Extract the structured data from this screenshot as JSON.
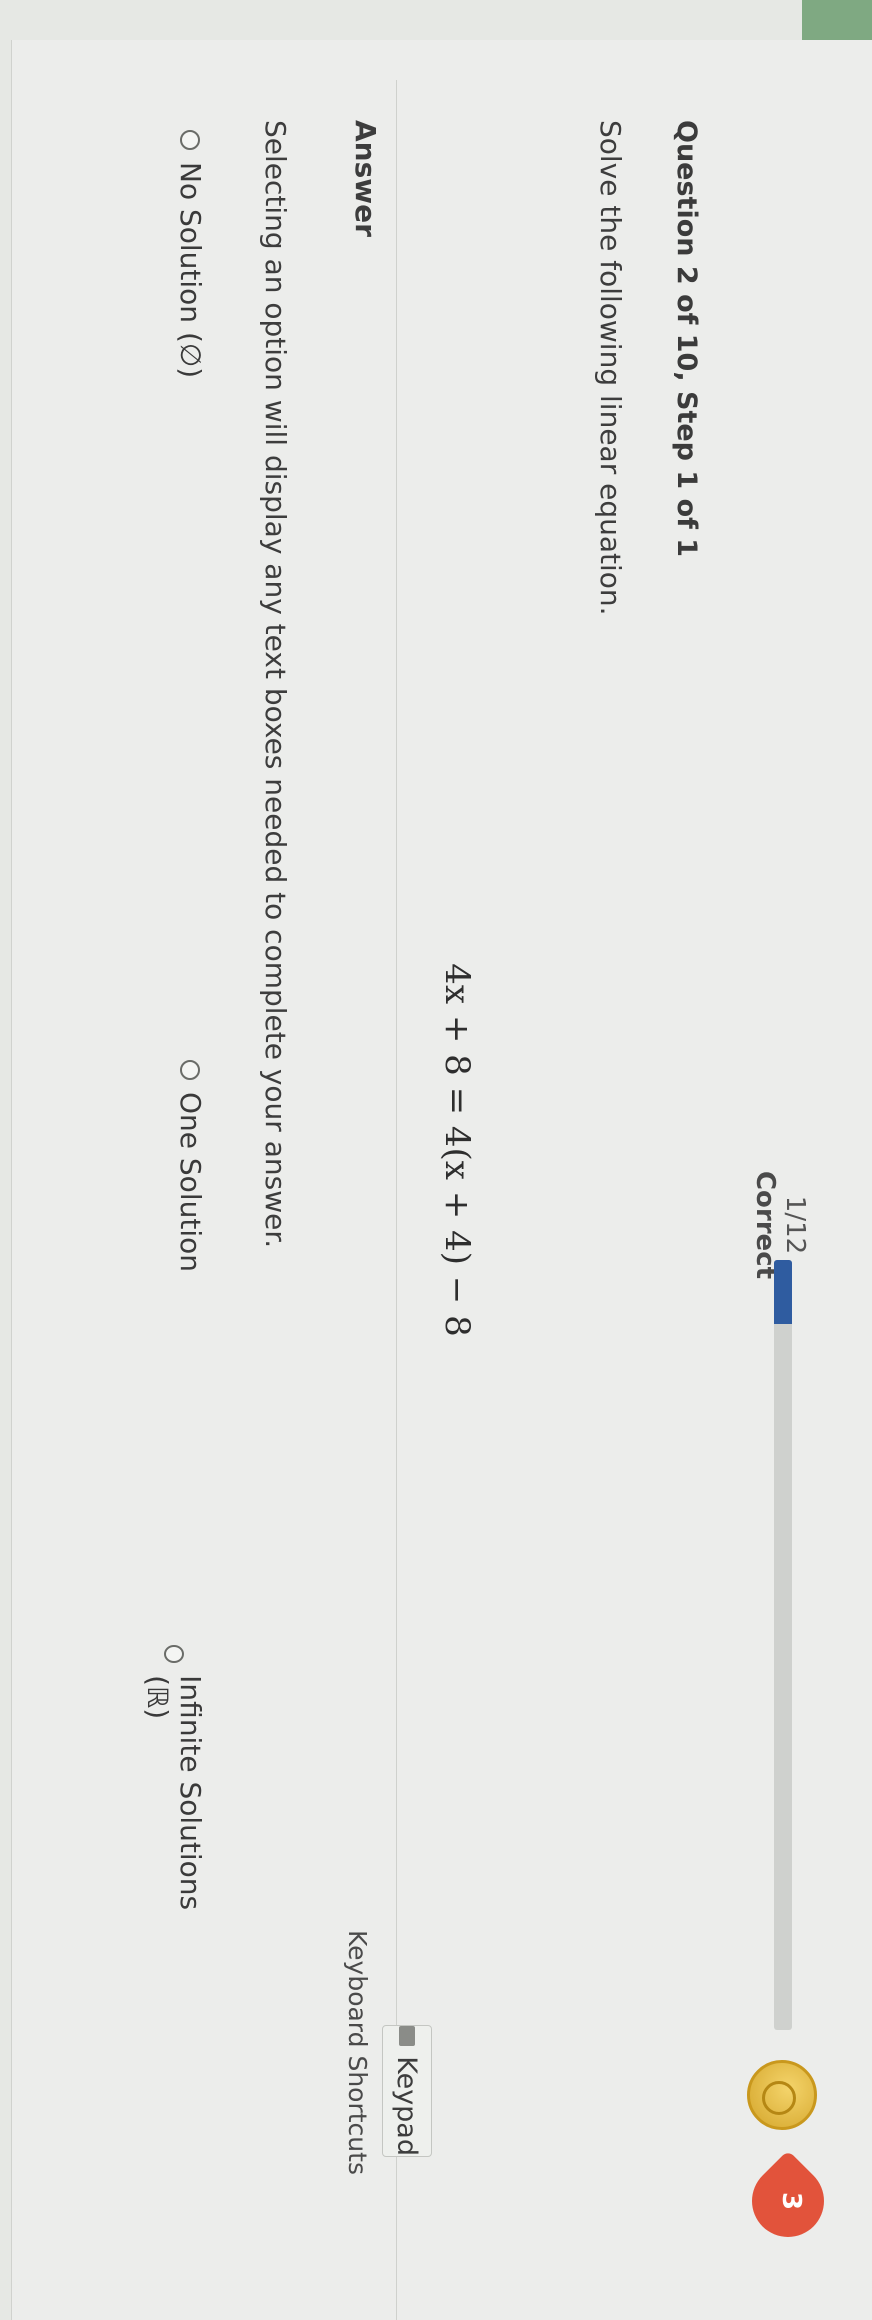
{
  "question": {
    "title": "Question 2 of 10, Step 1 of 1",
    "prompt": "Solve the following linear equation.",
    "equation": "4x + 8 = 4(x + 4) − 8"
  },
  "progress": {
    "count": "1/12",
    "label": "Correct",
    "fraction": 0.083
  },
  "streak": {
    "count": "3"
  },
  "answer": {
    "label": "Answer",
    "keypad_label": "Keypad",
    "shortcuts_label": "Keyboard Shortcuts",
    "instruction": "Selecting an option will display any text boxes needed to complete your answer.",
    "options": [
      {
        "label": "No Solution (∅)"
      },
      {
        "label": "One Solution"
      },
      {
        "label": "Infinite Solutions (ℝ)"
      }
    ]
  },
  "colors": {
    "accent": "#2f5ca0",
    "streak": "#e2533b",
    "coin": "#d4a52a",
    "frame": "#7fa982"
  },
  "icons": [
    "coin-icon",
    "streak-flame-icon",
    "keypad-icon",
    "radio-icon"
  ]
}
